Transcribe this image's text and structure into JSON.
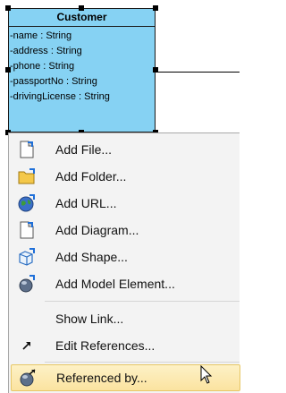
{
  "uml_class": {
    "name": "Customer",
    "attributes": [
      "-name : String",
      "-address : String",
      "-phone : String",
      "-passportNo : String",
      "-drivingLicense : String"
    ]
  },
  "menu": {
    "items": [
      {
        "label": "Add File...",
        "icon": "file-icon"
      },
      {
        "label": "Add Folder...",
        "icon": "folder-icon"
      },
      {
        "label": "Add URL...",
        "icon": "globe-icon"
      },
      {
        "label": "Add Diagram...",
        "icon": "diagram-icon"
      },
      {
        "label": "Add Shape...",
        "icon": "shape-icon"
      },
      {
        "label": "Add Model Element...",
        "icon": "model-element-icon"
      },
      {
        "label": "Show Link...",
        "icon": ""
      },
      {
        "label": "Edit References...",
        "icon": "arrow-icon"
      },
      {
        "label": "Referenced by...",
        "icon": "referenced-by-icon"
      }
    ],
    "highlighted_item": "Referenced by..."
  },
  "colors": {
    "uml_fill": "#86d2f3",
    "menu_bg": "#f3f3f3",
    "highlight": "#fbe3a0"
  }
}
